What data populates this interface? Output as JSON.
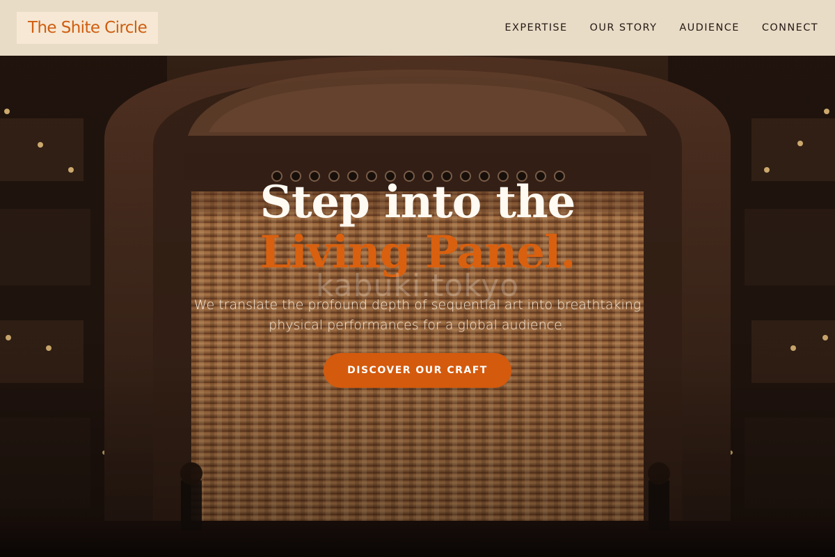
{
  "brand": {
    "logo_text": "The Shite Circle"
  },
  "nav": {
    "items": [
      {
        "label": "EXPERTISE"
      },
      {
        "label": "OUR STORY"
      },
      {
        "label": "AUDIENCE"
      },
      {
        "label": "CONNECT"
      }
    ]
  },
  "hero": {
    "headline_line1": "Step into the",
    "headline_line2": "Living Panel.",
    "watermark": "kabuki.tokyo",
    "subtext": "We translate the profound depth of sequential art into breathtaking physical performances for a global audience.",
    "cta_label": "DISCOVER OUR CRAFT"
  },
  "colors": {
    "accent": "#d45a0d",
    "header_bg": "#e9dcc7",
    "logo_bg": "#f6e8d4",
    "headline": "#fffaf2"
  }
}
